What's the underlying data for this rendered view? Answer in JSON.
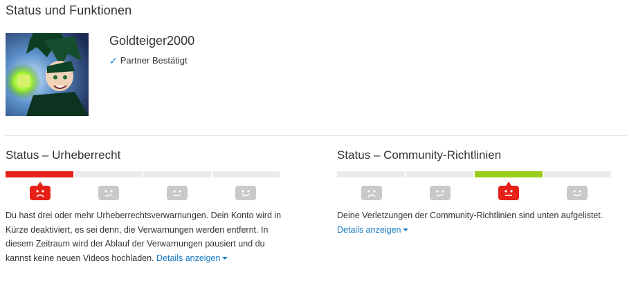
{
  "page": {
    "title": "Status und Funktionen"
  },
  "account": {
    "name": "Goldteiger2000",
    "partner_status": "Partner Bestätigt",
    "avatar_icon": "anime-character-avatar"
  },
  "copyright": {
    "title": "Status – Urheberrecht",
    "progress_segments_filled": 1,
    "progress_segments_total": 4,
    "active_level": 1,
    "description": "Du hast drei oder mehr Urheberrechtsverwarnungen. Dein Konto wird in Kürze deaktiviert, es sei denn, die Verwarnungen werden entfernt. In diesem Zeitraum wird der Ablauf der Verwarnungen pausiert und du kannst keine neuen Videos hochladen.",
    "details_label": "Details anzeigen",
    "accent_color": "#e62117"
  },
  "community": {
    "title": "Status – Community-Richtlinien",
    "active_level": 3,
    "description": "Deine Verletzungen der Community-Richtlinien sind unten aufgelistet.",
    "details_label": "Details anzeigen",
    "accent_color": "#9acd1c",
    "face_color": "#e62117"
  },
  "colors": {
    "link": "#167ac6",
    "inactive": "#c9c9c9",
    "bar_bg": "#ebebeb"
  }
}
